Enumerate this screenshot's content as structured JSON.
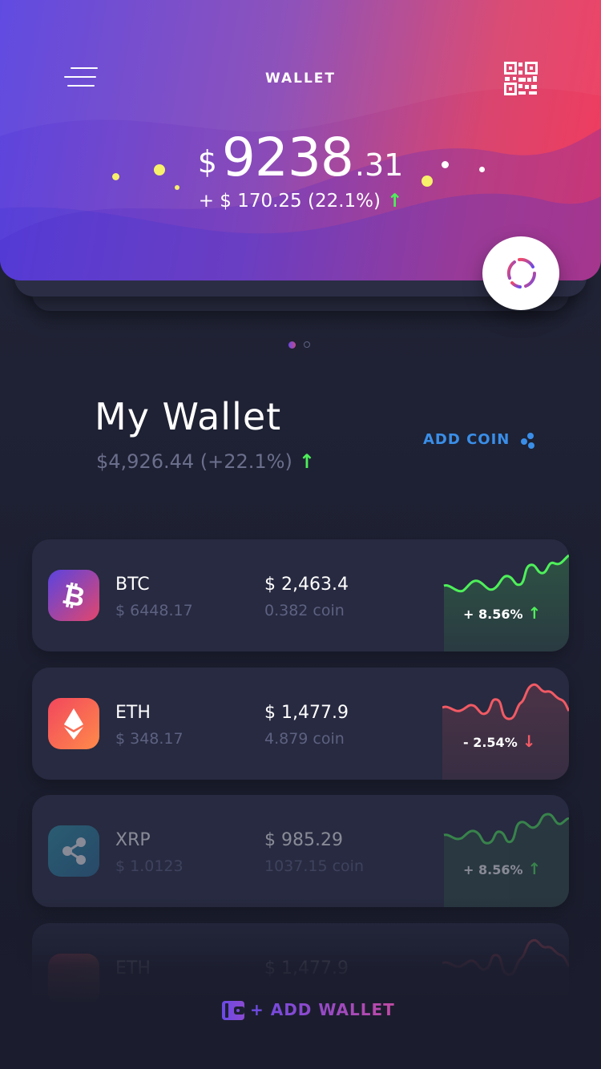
{
  "header": {
    "title": "WALLET",
    "balance_currency": "$",
    "balance_int": "9238",
    "balance_dec": ".31",
    "change_text": "+ $ 170.25 (22.1%)",
    "change_arrow": "↑",
    "menu_icon": "hamburger-menu-icon",
    "qr_icon": "qr-code-icon",
    "refresh_icon": "refresh-icon"
  },
  "pager": {
    "pages": 2,
    "active": 0
  },
  "wallet": {
    "title": "My Wallet",
    "subtitle": "$4,926.44 (+22.1%)",
    "subtitle_arrow": "↑",
    "add_coin_label": "ADD COIN",
    "add_coin_icon": "add-coin-dots-icon"
  },
  "coins": [
    {
      "symbol": "BTC",
      "price": "$ 6448.17",
      "value": "$ 2,463.4",
      "amount": "0.382 coin",
      "change": "+ 8.56%",
      "arrow": "↑",
      "trend": "up",
      "icon": "bitcoin-icon"
    },
    {
      "symbol": "ETH",
      "price": "$ 348.17",
      "value": "$ 1,477.9",
      "amount": "4.879 coin",
      "change": "- 2.54%",
      "arrow": "↓",
      "trend": "down",
      "icon": "ethereum-icon"
    },
    {
      "symbol": "XRP",
      "price": "$ 1.0123",
      "value": "$ 985.29",
      "amount": "1037.15 coin",
      "change": "+ 8.56%",
      "arrow": "↑",
      "trend": "up",
      "icon": "ripple-icon"
    },
    {
      "symbol": "ETH",
      "price": "",
      "value": "$ 1,477.9",
      "amount": "",
      "change": "",
      "arrow": "",
      "trend": "down",
      "icon": "ethereum-icon"
    }
  ],
  "footer": {
    "add_wallet_label": "+ ADD WALLET",
    "add_wallet_icon": "wallet-icon"
  },
  "colors": {
    "up": "#4ef05a",
    "down": "#f25a64",
    "accent_blue": "#3a8ee8",
    "card": "#272a40",
    "background": "#1c1f31"
  }
}
